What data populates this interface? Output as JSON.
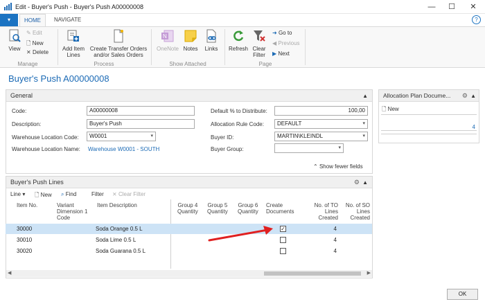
{
  "window": {
    "title": "Edit - Buyer's Push - Buyer's Push A00000008",
    "minimize": "—",
    "maximize": "☐",
    "close": "✕"
  },
  "ribbon": {
    "tabs": [
      "HOME",
      "NAVIGATE"
    ],
    "manage": {
      "group_label": "Manage",
      "view": "View",
      "edit": "Edit",
      "new": "New",
      "delete": "Delete"
    },
    "process": {
      "group_label": "Process",
      "add_item_lines_1": "Add Item",
      "add_item_lines_2": "Lines",
      "create_transfer_1": "Create Transfer Orders",
      "create_transfer_2": "and/or Sales Orders"
    },
    "show_attached": {
      "group_label": "Show Attached",
      "onenote": "OneNote",
      "notes": "Notes",
      "links": "Links"
    },
    "page": {
      "group_label": "Page",
      "refresh": "Refresh",
      "clear_filter_1": "Clear",
      "clear_filter_2": "Filter",
      "go_to": "Go to",
      "previous": "Previous",
      "next": "Next"
    }
  },
  "page_title": "Buyer's Push A00000008",
  "general": {
    "header": "General",
    "code_label": "Code:",
    "code_value": "A00000008",
    "description_label": "Description:",
    "description_value": "Buyer's Push",
    "wh_code_label": "Warehouse Location Code:",
    "wh_code_value": "W0001",
    "wh_name_label": "Warehouse Location Name:",
    "wh_name_value": "Warehouse W0001 - SOUTH",
    "default_pct_label": "Default % to Distribute:",
    "default_pct_value": "100,00",
    "alloc_rule_label": "Allocation Rule Code:",
    "alloc_rule_value": "DEFAULT",
    "buyer_id_label": "Buyer ID:",
    "buyer_id_value": "MARTIN\\KLEINDL",
    "buyer_group_label": "Buyer Group:",
    "buyer_group_value": "",
    "show_fewer": "Show fewer fields"
  },
  "lines": {
    "header": "Buyer's Push Lines",
    "toolbar": {
      "line": "Line",
      "new": "New",
      "find": "Find",
      "filter": "Filter",
      "clear_filter": "Clear Filter"
    },
    "columns": {
      "item_no": "Item No.",
      "variant_1": "Variant",
      "variant_2": "Dimension 1",
      "variant_3": "Code",
      "item_desc": "Item Description",
      "g4_1": "Group 4",
      "g4_2": "Quantity",
      "g5_1": "Group 5",
      "g5_2": "Quantity",
      "g6_1": "Group 6",
      "g6_2": "Quantity",
      "create_1": "Create",
      "create_2": "Documents",
      "to_1": "No. of TO",
      "to_2": "Lines",
      "to_3": "Created",
      "so_1": "No. of SO",
      "so_2": "Lines",
      "so_3": "Created"
    },
    "rows": [
      {
        "item_no": "30000",
        "description": "Soda Orange 0.5 L",
        "create": true,
        "to_lines": "4",
        "selected": true
      },
      {
        "item_no": "30010",
        "description": "Soda Lime 0.5 L",
        "create": false,
        "to_lines": "4",
        "selected": false
      },
      {
        "item_no": "30020",
        "description": "Soda Guarana 0.5 L",
        "create": false,
        "to_lines": "4",
        "selected": false
      }
    ]
  },
  "factbox": {
    "header": "Allocation Plan Docume...",
    "new": "New",
    "value": "4"
  },
  "ok_button": "OK",
  "colors": {
    "accent": "#1b73c2",
    "selected_row": "#cde3f6",
    "arrow": "#e02020"
  }
}
